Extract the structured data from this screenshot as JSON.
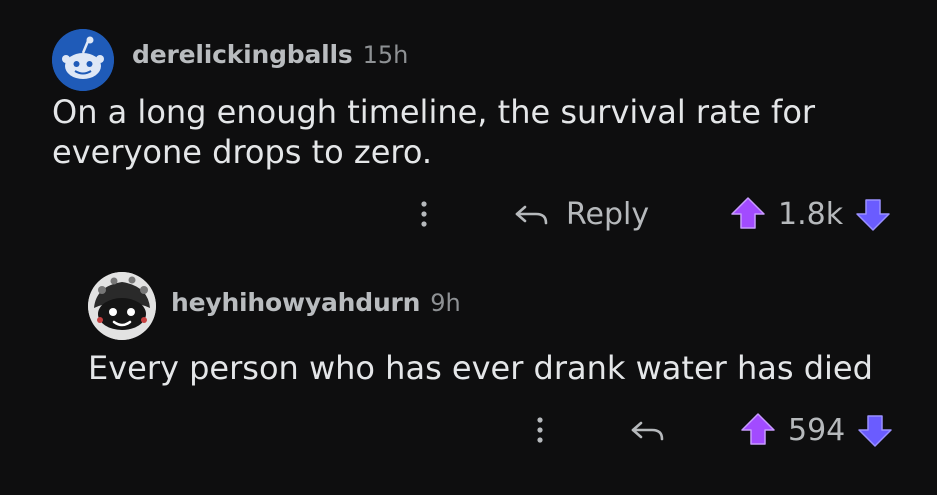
{
  "colors": {
    "background": "#0e0e0f",
    "text": "#e4e6e8",
    "meta_text": "#b9bcbf",
    "upvote_accent": "#a24bff",
    "downvote_accent": "#6a5cff",
    "icon_muted": "#b6b9bc"
  },
  "comments": [
    {
      "username": "derelickingballs",
      "age": "15h",
      "text": "On a long enough timeline, the survival rate for\neveryone drops to zero.",
      "avatar_icon": "snoo-avatar-icon",
      "reply_label": "Reply",
      "score": "1.8k"
    },
    {
      "username": "heyhihowyahdurn",
      "age": "9h",
      "text": "Every person who has ever drank water has died",
      "avatar_icon": "custom-avatar-icon",
      "reply_label": "",
      "score": "594"
    }
  ]
}
